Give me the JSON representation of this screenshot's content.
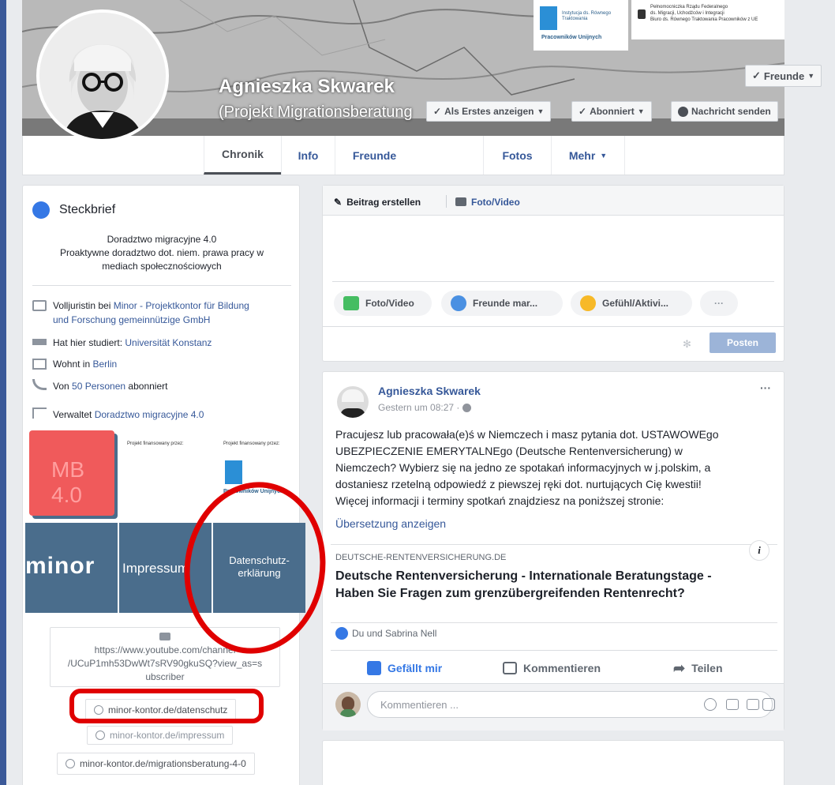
{
  "profile": {
    "name": "Agnieszka Skwarek",
    "subtitle": "(Projekt Migrationsberatung",
    "friends_button": "Freunde",
    "actions": [
      "Als Erstes anzeigen",
      "Abonniert",
      "Nachricht senden"
    ],
    "more": "···"
  },
  "cover_logos": {
    "logo1_line1": "Instytucja ds. Równego",
    "logo1_line2": "Traktowania",
    "logo1_line3": "Pracowników Unijnych",
    "logo2_line1": "Pełnomocniczka Rządu Federalnego",
    "logo2_line2": "ds. Migracji, Uchodźców i Integracji",
    "logo2_line3": "Biuro ds. Równego Traktowania Pracowników z UE"
  },
  "nav": {
    "tabs": [
      "Chronik",
      "Info",
      "Freunde",
      "Fotos",
      "Mehr"
    ]
  },
  "intro": {
    "title": "Steckbrief",
    "bio_line1": "Doradztwo migracyjne 4.0",
    "bio_line2": "Proaktywne doradztwo dot. niem. prawa pracy w",
    "bio_line3": "mediach społecznościowych",
    "work_prefix": "Volljuristin bei ",
    "work_link": "Minor - Projektkontor für Bildung",
    "work_link2": "und Forschung gemeinnützige GmbH",
    "study_prefix": "Hat hier studiert: ",
    "study_link": "Universität Konstanz",
    "lives_prefix": "Wohnt in ",
    "lives_link": "Berlin",
    "followers_prefix": "Von ",
    "followers_link": "50 Personen",
    "followers_suffix": " abonniert",
    "manages_prefix": "Verwaltet ",
    "manages_link": "Doradztwo migracyjne 4.0",
    "tile_mb": "MB",
    "tile_40": "4.0",
    "funded1": "Projekt finansowany przez:",
    "funded2": "Projekt finansowany przez:",
    "funded_logo_text": "Pracowników Unijnych",
    "minor": "minor",
    "impressum": "Impressum",
    "datenschutz_1": "Datenschutz-",
    "datenschutz_2": "erklärung",
    "youtube_line1": "https://www.youtube.com/channel",
    "youtube_line2": "/UCuP1mh53DwWt7sRV90gkuSQ?view_as=s",
    "youtube_line3": "ubscriber",
    "link_datenschutz": "minor-kontor.de/datenschutz",
    "link_impressum": "minor-kontor.de/impressum",
    "link_migration": "minor-kontor.de/migrationsberatung-4-0"
  },
  "composer": {
    "create_post": "Beitrag erstellen",
    "photo_video_tab": "Foto/Video",
    "pill_photo": "Foto/Video",
    "pill_friends": "Freunde mar...",
    "pill_feeling": "Gefühl/Aktivi...",
    "pill_more": "···",
    "post_button": "Posten"
  },
  "post": {
    "author": "Agnieszka Skwarek",
    "time": "Gestern um 08:27 ·",
    "menu": "···",
    "text_line1": "Pracujesz lub pracowała(e)ś w Niemczech i masz pytania dot. USTAWOWEgo",
    "text_line2": "UBEZPIECZENIE EMERYTALNEgo (Deutsche Rentenversicherung) w",
    "text_line3": "Niemczech? Wybierz się na jedno ze spotakań informacyjnych w j.polskim, a",
    "text_line4": "dostaniesz rzetelną odpowiedź z piewszej ręki dot. nurtujących Cię kwestii!",
    "text_line5": "Więcej informacji i terminy spotkań znajdziesz na poniższej stronie:",
    "translate": "Übersetzung anzeigen",
    "link_domain": "DEUTSCHE-RENTENVERSICHERUNG.DE",
    "link_title1": "Deutsche Rentenversicherung - Internationale Beratungstage -",
    "link_title2": "Haben Sie Fragen zum grenzübergreifenden Rentenrecht?",
    "info_glyph": "i",
    "likes": "Du und Sabrina Nell",
    "like": "Gefällt mir",
    "comment": "Kommentieren",
    "share": "Teilen",
    "comment_placeholder": "Kommentieren ..."
  },
  "colors": {
    "brand": "#3b5998",
    "link": "#365899",
    "annotation": "#e00000",
    "tile_blue": "#4a6d8c",
    "tile_red": "#f05a5b"
  }
}
